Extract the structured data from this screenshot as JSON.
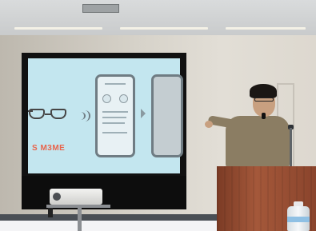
{
  "scene": {
    "slide_text": "S M3ME"
  }
}
